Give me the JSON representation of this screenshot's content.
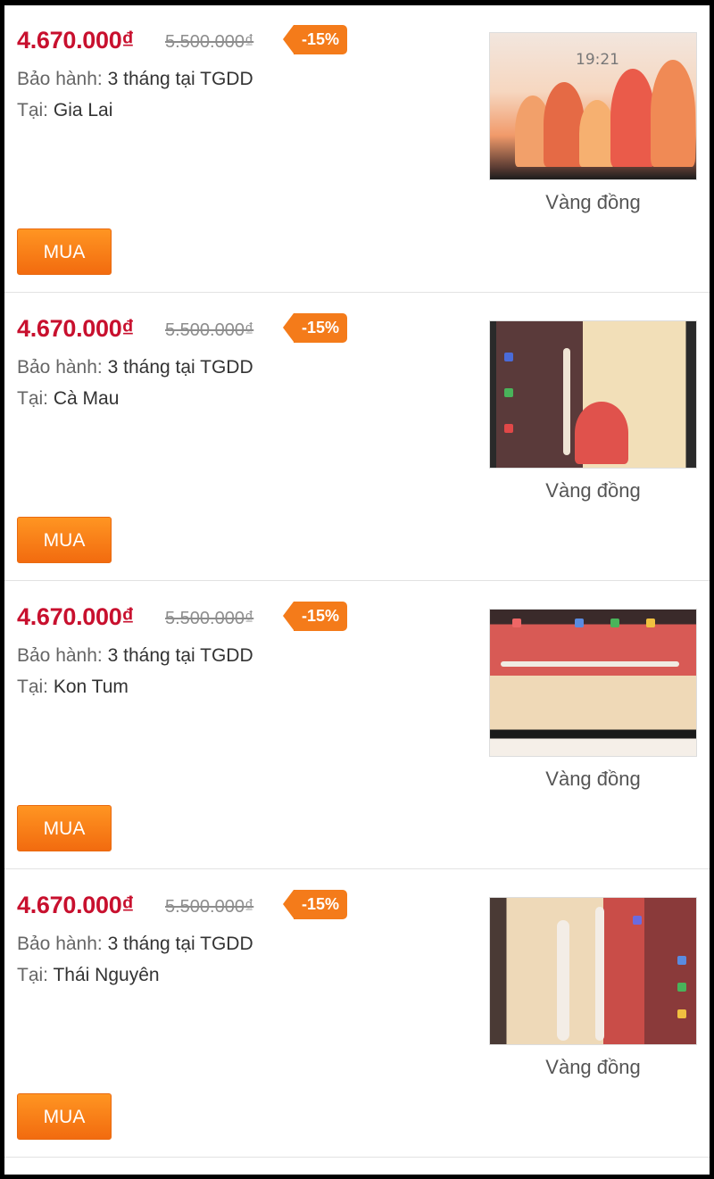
{
  "items": [
    {
      "price": "4.670.000₫",
      "old_price": "5.500.000₫",
      "discount": "-15%",
      "warranty_label": "Bảo hành:",
      "warranty_value": "3 tháng tại TGDD",
      "location_label": "Tại:",
      "location_value": "Gia Lai",
      "color": "Vàng đồng",
      "buy_label": "MUA",
      "screen_time": "19:21"
    },
    {
      "price": "4.670.000₫",
      "old_price": "5.500.000₫",
      "discount": "-15%",
      "warranty_label": "Bảo hành:",
      "warranty_value": "3 tháng tại TGDD",
      "location_label": "Tại:",
      "location_value": "Cà Mau",
      "color": "Vàng đồng",
      "buy_label": "MUA"
    },
    {
      "price": "4.670.000₫",
      "old_price": "5.500.000₫",
      "discount": "-15%",
      "warranty_label": "Bảo hành:",
      "warranty_value": "3 tháng tại TGDD",
      "location_label": "Tại:",
      "location_value": "Kon Tum",
      "color": "Vàng đồng",
      "buy_label": "MUA"
    },
    {
      "price": "4.670.000₫",
      "old_price": "5.500.000₫",
      "discount": "-15%",
      "warranty_label": "Bảo hành:",
      "warranty_value": "3 tháng tại TGDD",
      "location_label": "Tại:",
      "location_value": "Thái Nguyên",
      "color": "Vàng đồng",
      "buy_label": "MUA"
    }
  ],
  "colors": {
    "price": "#c8102e",
    "discount_bg": "#f47b1a",
    "buy_button": "#f47b1a"
  }
}
